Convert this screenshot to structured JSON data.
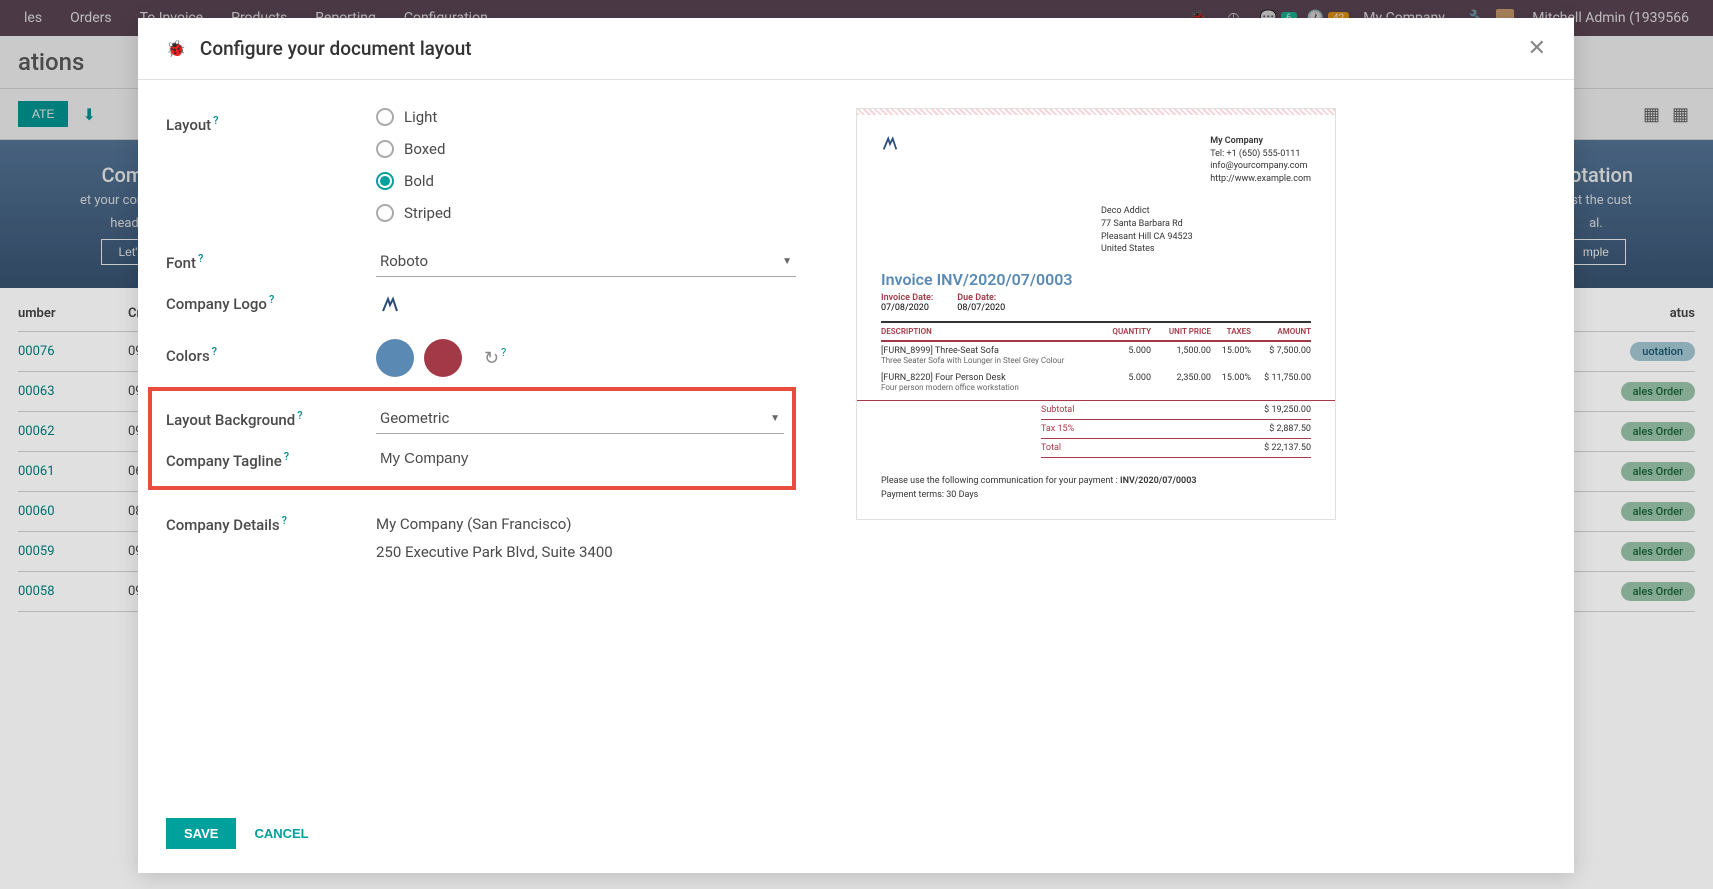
{
  "topbar": {
    "menu": [
      "les",
      "Orders",
      "To Invoice",
      "Products",
      "Reporting",
      "Configuration"
    ],
    "msg_count": "6",
    "clock_count": "42",
    "company": "My Company",
    "user": "Mitchell Admin (1939566"
  },
  "subheader": {
    "title": "ations",
    "create_label": "ATE"
  },
  "banner": {
    "left_title": "Comp",
    "left_sub1": "et your company",
    "left_sub2": "heade",
    "left_btn": "Let'",
    "right_title": "uotation",
    "right_sub1": "test the cust",
    "right_sub2": "al.",
    "right_btn": "mple"
  },
  "table": {
    "head_number": "umber",
    "head_created": "Cr",
    "head_status": "atus",
    "rows": [
      {
        "num": "00076",
        "dt": "09",
        "status": "uotation",
        "cls": "quot"
      },
      {
        "num": "00063",
        "dt": "09",
        "status": "ales Order",
        "cls": "sale"
      },
      {
        "num": "00062",
        "dt": "09",
        "status": "ales Order",
        "cls": "sale"
      },
      {
        "num": "00061",
        "dt": "06",
        "status": "ales Order",
        "cls": "sale"
      },
      {
        "num": "00060",
        "dt": "08",
        "status": "ales Order",
        "cls": "sale"
      },
      {
        "num": "00059",
        "dt": "09",
        "status": "ales Order",
        "cls": "sale"
      },
      {
        "num": "00058",
        "dt": "09",
        "status": "ales Order",
        "cls": "sale"
      }
    ]
  },
  "modal": {
    "title": "Configure your document layout",
    "labels": {
      "layout": "Layout",
      "font": "Font",
      "company_logo": "Company Logo",
      "colors": "Colors",
      "layout_bg": "Layout Background",
      "company_tagline": "Company Tagline",
      "company_details": "Company Details"
    },
    "layout_options": {
      "light": "Light",
      "boxed": "Boxed",
      "bold": "Bold",
      "striped": "Striped"
    },
    "font_value": "Roboto",
    "bg_value": "Geometric",
    "tagline_value": "My Company",
    "details_line1": "My Company (San Francisco)",
    "details_line2": "250 Executive Park Blvd, Suite 3400",
    "save_label": "SAVE",
    "cancel_label": "CANCEL"
  },
  "preview": {
    "company_name": "My Company",
    "tel": "Tel: +1 (650) 555-0111",
    "email": "info@yourcompany.com",
    "website": "http://www.example.com",
    "addr_name": "Deco Addict",
    "addr_street": "77 Santa Barbara Rd",
    "addr_city": "Pleasant Hill CA 94523",
    "addr_country": "United States",
    "invoice_title": "Invoice INV/2020/07/0003",
    "invoice_date_lbl": "Invoice Date:",
    "invoice_date": "07/08/2020",
    "due_date_lbl": "Due Date:",
    "due_date": "08/07/2020",
    "th_desc": "DESCRIPTION",
    "th_qty": "QUANTITY",
    "th_price": "UNIT PRICE",
    "th_tax": "TAXES",
    "th_amt": "AMOUNT",
    "line1_desc": "[FURN_8999] Three-Seat Sofa",
    "line1_sub": "Three Seater Sofa with Lounger in Steel Grey Colour",
    "line1_qty": "5.000",
    "line1_price": "1,500.00",
    "line1_tax": "15.00%",
    "line1_amt": "$ 7,500.00",
    "line2_desc": "[FURN_8220] Four Person Desk",
    "line2_sub": "Four person modern office workstation",
    "line2_qty": "5.000",
    "line2_price": "2,350.00",
    "line2_tax": "15.00%",
    "line2_amt": "$ 11,750.00",
    "subtotal_lbl": "Subtotal",
    "subtotal": "$ 19,250.00",
    "tax_lbl": "Tax 15%",
    "tax_val": "$ 2,887.50",
    "total_lbl": "Total",
    "total": "$ 22,137.50",
    "comm_text": "Please use the following communication for your payment : ",
    "comm_ref": "INV/2020/07/0003",
    "payment_terms": "Payment terms: 30 Days"
  }
}
